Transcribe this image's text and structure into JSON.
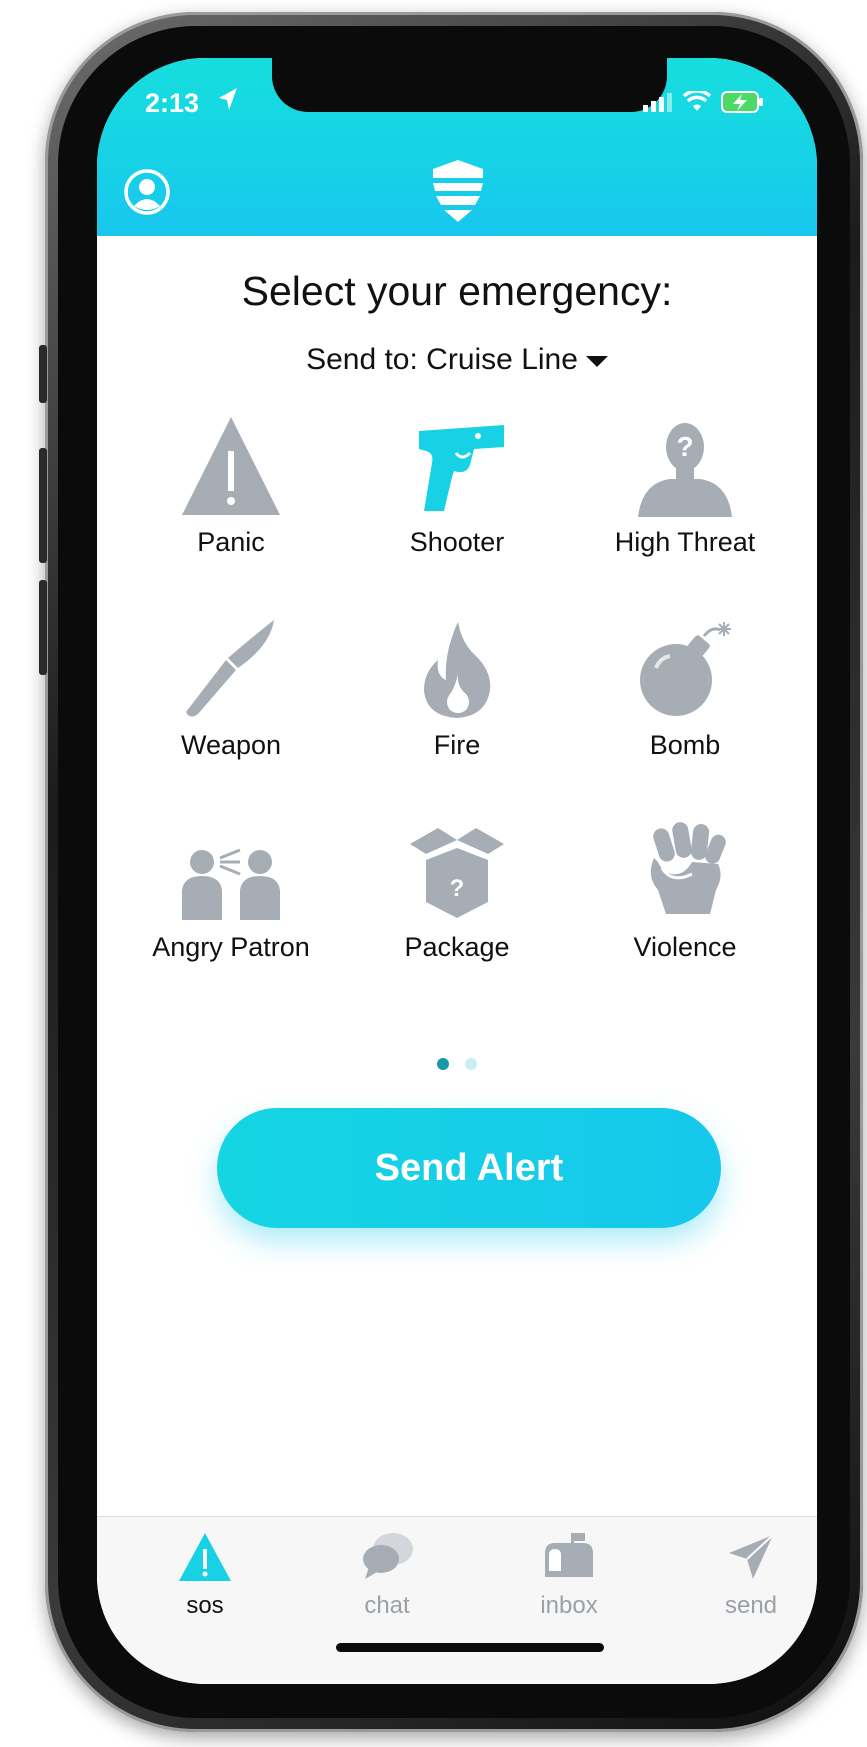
{
  "status_bar": {
    "time": "2:13"
  },
  "header": {
    "avatar_icon": "user-avatar-icon",
    "logo_icon": "shield-logo-icon"
  },
  "title": "Select your emergency:",
  "send_to": {
    "label": "Send to: Cruise Line"
  },
  "emergencies": [
    {
      "label": "Panic",
      "icon": "warning-triangle-icon",
      "selected": false
    },
    {
      "label": "Shooter",
      "icon": "gun-icon",
      "selected": true
    },
    {
      "label": "High Threat",
      "icon": "unknown-person-icon",
      "selected": false
    },
    {
      "label": "Weapon",
      "icon": "knife-icon",
      "selected": false
    },
    {
      "label": "Fire",
      "icon": "fire-icon",
      "selected": false
    },
    {
      "label": "Bomb",
      "icon": "bomb-icon",
      "selected": false
    },
    {
      "label": "Angry Patron",
      "icon": "angry-patron-icon",
      "selected": false
    },
    {
      "label": "Package",
      "icon": "package-icon",
      "selected": false
    },
    {
      "label": "Violence",
      "icon": "fist-icon",
      "selected": false
    }
  ],
  "pagination": {
    "pages": 2,
    "current": 1
  },
  "send_alert": {
    "label": "Send Alert"
  },
  "tabbar": [
    {
      "label": "sos",
      "icon": "sos-icon",
      "active": true
    },
    {
      "label": "chat",
      "icon": "chat-icon",
      "active": false
    },
    {
      "label": "inbox",
      "icon": "mailbox-icon",
      "active": false
    },
    {
      "label": "send",
      "icon": "paper-plane-icon",
      "active": false
    }
  ],
  "colors": {
    "accent": "#16d2e4",
    "icon_gray": "#a7adb5",
    "dot_active": "#1b98a8",
    "dot_inactive": "#c9eef2",
    "tab_inactive": "#9aa0a6"
  }
}
